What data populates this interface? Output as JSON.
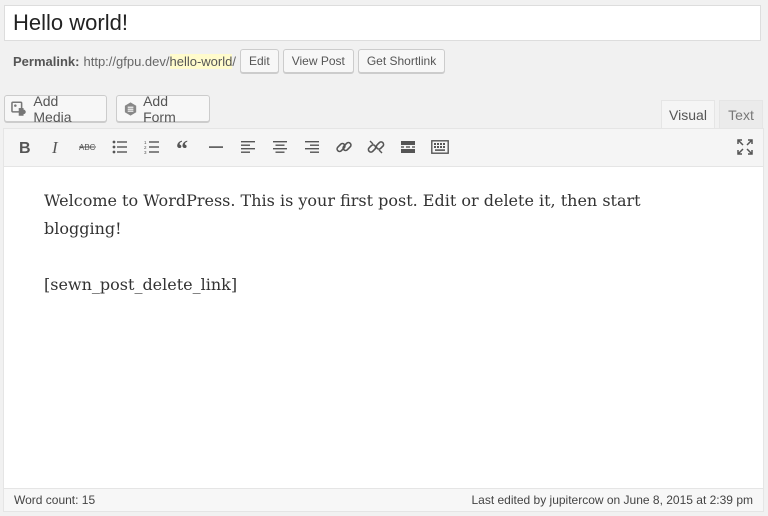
{
  "post": {
    "title": "Hello world!"
  },
  "permalink": {
    "label": "Permalink:",
    "base_url": "http://gfpu.dev/",
    "slug": "hello-world",
    "trailing": "/",
    "edit_label": "Edit",
    "view_label": "View Post",
    "shortlink_label": "Get Shortlink"
  },
  "media_buttons": {
    "add_media_label": "Add Media",
    "add_form_label": "Add Form"
  },
  "editor_tabs": {
    "visual_label": "Visual",
    "text_label": "Text"
  },
  "toolbar": {
    "icons": [
      "bold-icon",
      "italic-icon",
      "strikethrough-icon",
      "bulleted-list-icon",
      "numbered-list-icon",
      "blockquote-icon",
      "horizontal-line-icon",
      "align-left-icon",
      "align-center-icon",
      "align-right-icon",
      "link-icon",
      "unlink-icon",
      "read-more-icon",
      "toolbar-toggle-icon",
      "fullscreen-icon"
    ]
  },
  "content": {
    "paragraph_1": "Welcome to WordPress. This is your first post. Edit or delete it, then start blogging!",
    "paragraph_2": "[sewn_post_delete_link]"
  },
  "status": {
    "word_count": "Word count: 15",
    "last_edited": "Last edited by jupitercow on June 8, 2015 at 2:39 pm"
  }
}
